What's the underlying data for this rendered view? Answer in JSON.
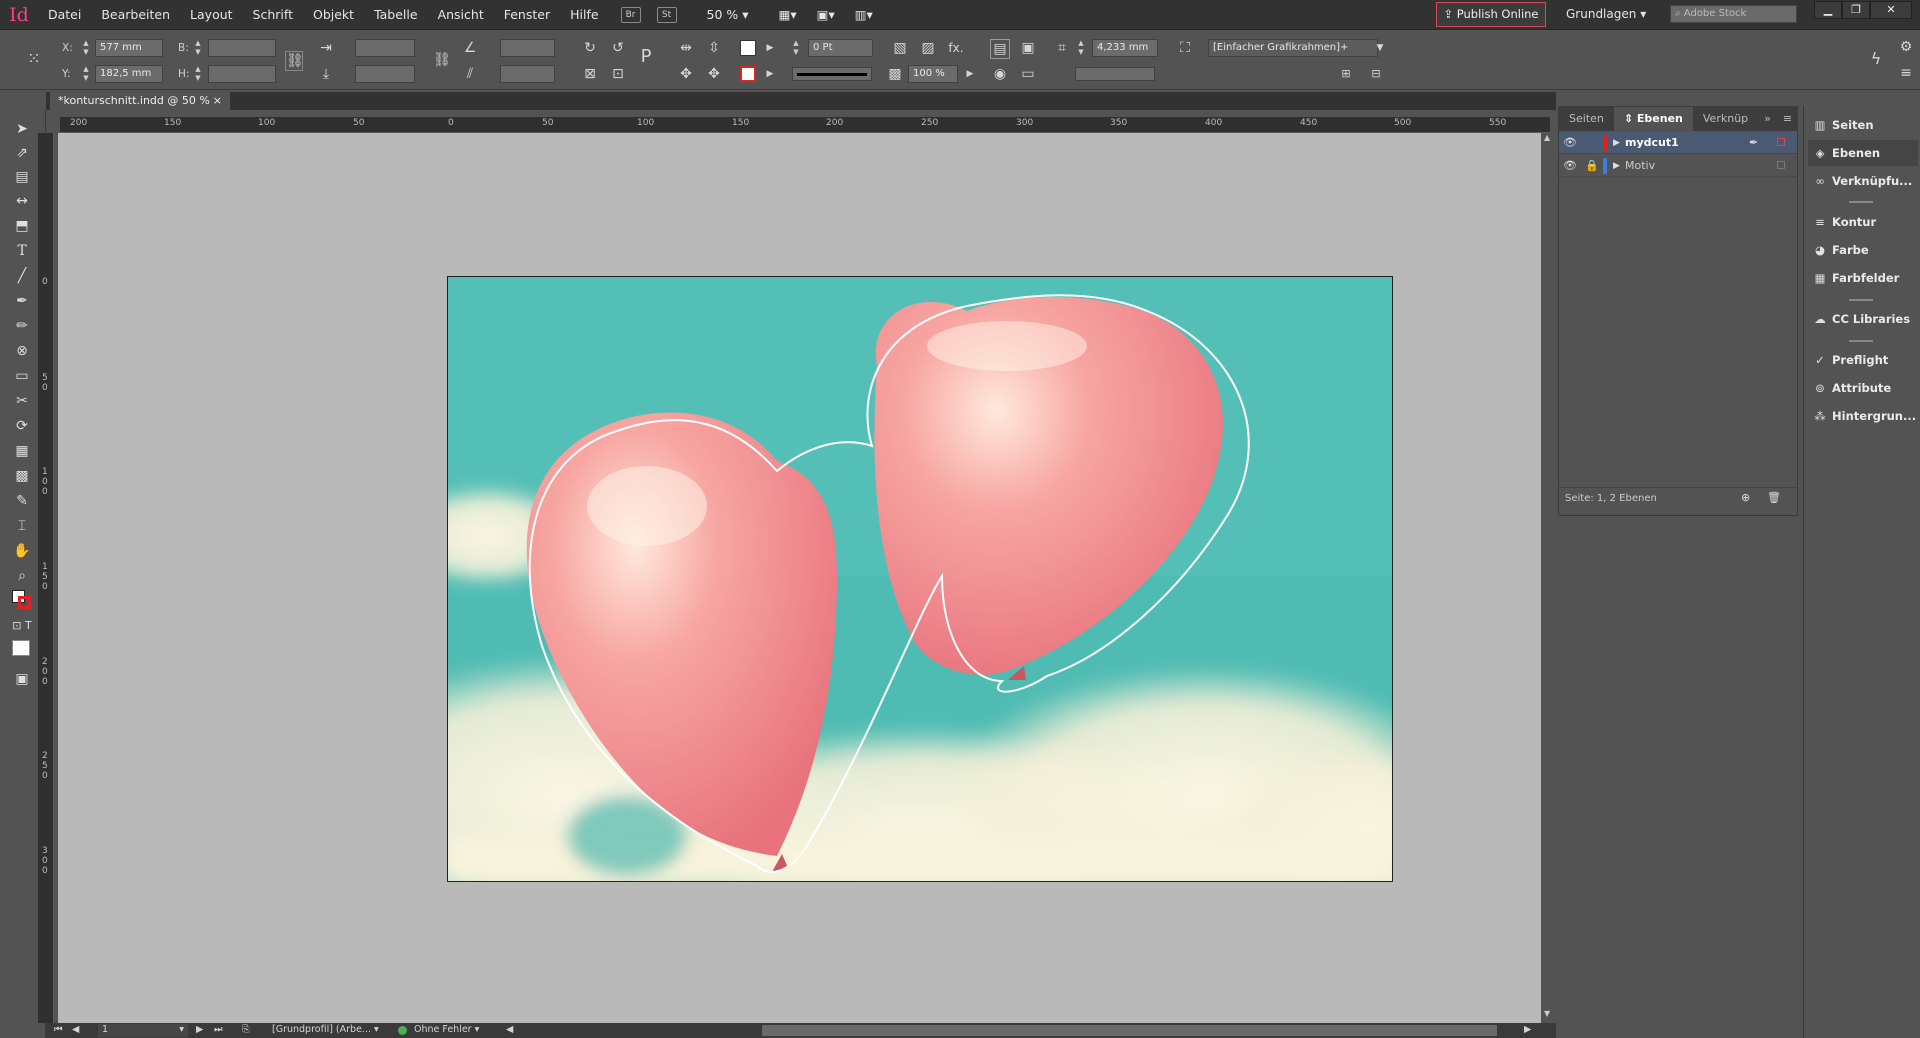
{
  "app": {
    "logo": "Id",
    "menu": [
      "Datei",
      "Bearbeiten",
      "Layout",
      "Schrift",
      "Objekt",
      "Tabelle",
      "Ansicht",
      "Fenster",
      "Hilfe"
    ],
    "bridge": "Br",
    "stock": "St",
    "zoom": "50 %",
    "publish": "Publish Online",
    "workspace": "Grundlagen",
    "search_placeholder": "Adobe Stock"
  },
  "control": {
    "x_label": "X:",
    "x_value": "577 mm",
    "y_label": "Y:",
    "y_value": "182,5 mm",
    "w_label": "B:",
    "h_label": "H:",
    "stroke_weight": "0 Pt",
    "opacity": "100 %",
    "offset": "4,233 mm",
    "object_style": "[Einfacher Grafikrahmen]+",
    "fx": "fx."
  },
  "document": {
    "tab": "*konturschnitt.indd @ 50 %",
    "close": "×"
  },
  "rulers": {
    "h": [
      "200",
      "150",
      "100",
      "50",
      "0",
      "50",
      "100",
      "150",
      "200",
      "250",
      "300",
      "350",
      "400",
      "450",
      "500",
      "550"
    ],
    "v": [
      "0",
      "5 0",
      "1 0 0",
      "1 5 0",
      "2 0 0",
      "2 5 0",
      "3 0 0"
    ]
  },
  "panel": {
    "tabs": [
      "Seiten",
      "Ebenen",
      "Verknüp"
    ],
    "layers": [
      {
        "name": "mydcut1",
        "color": "#e01f1f"
      },
      {
        "name": "Motiv",
        "color": "#3a7de0"
      }
    ],
    "footer": "Seite: 1, 2 Ebenen"
  },
  "dock": [
    "Seiten",
    "Ebenen",
    "Verknüpfu...",
    "Kontur",
    "Farbe",
    "Farbfelder",
    "CC Libraries",
    "Preflight",
    "Attribute",
    "Hintergrun..."
  ],
  "status": {
    "page": "1",
    "profile": "[Grundprofil] (Arbe...",
    "errors": "Ohne Fehler"
  },
  "colors": {
    "sky": "#4fbcb3",
    "balloon": "#ef8a8e",
    "accent_publish": "#d24a5a"
  }
}
